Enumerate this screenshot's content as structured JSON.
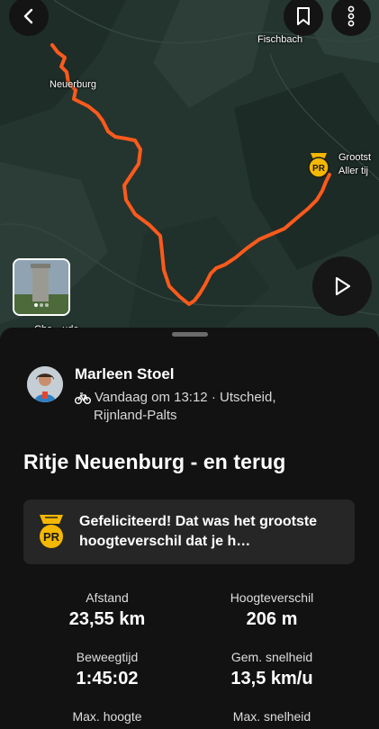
{
  "map": {
    "places": {
      "fischbach": "Fischbach",
      "neuerburg": "Neuerburg",
      "grootste_line1": "Grootst",
      "grootste_line2": "Aller tij",
      "photo_caption": "Che…ude"
    },
    "route_color": "#fc5a1c",
    "icons": {
      "back": "chevron-left-icon",
      "bookmark": "bookmark-icon",
      "more": "more-vertical-icon",
      "play": "play-icon",
      "pr": "pr-medal-icon"
    },
    "photo_pager": "photo 1 of 3"
  },
  "activity": {
    "athlete_name": "Marleen Stoel",
    "when_where_line1": "Vandaag om 13:12 · Utscheid,",
    "when_where_line2": "Rijnland-Palts",
    "sport_icon": "bike-icon",
    "title": "Ritje Neuenburg - en terug",
    "achievement": {
      "badge": "PR",
      "text": "Gefeliciteerd! Dat was het grootste hoogteverschil dat je h…"
    },
    "stats": [
      {
        "label": "Afstand",
        "value": "23,55 km"
      },
      {
        "label": "Hoogteverschil",
        "value": "206 m"
      },
      {
        "label": "Beweegtijd",
        "value": "1:45:02"
      },
      {
        "label": "Gem. snelheid",
        "value": "13,5 km/u"
      },
      {
        "label": "Max. hoogte",
        "value": ""
      },
      {
        "label": "Max. snelheid",
        "value": ""
      }
    ]
  }
}
